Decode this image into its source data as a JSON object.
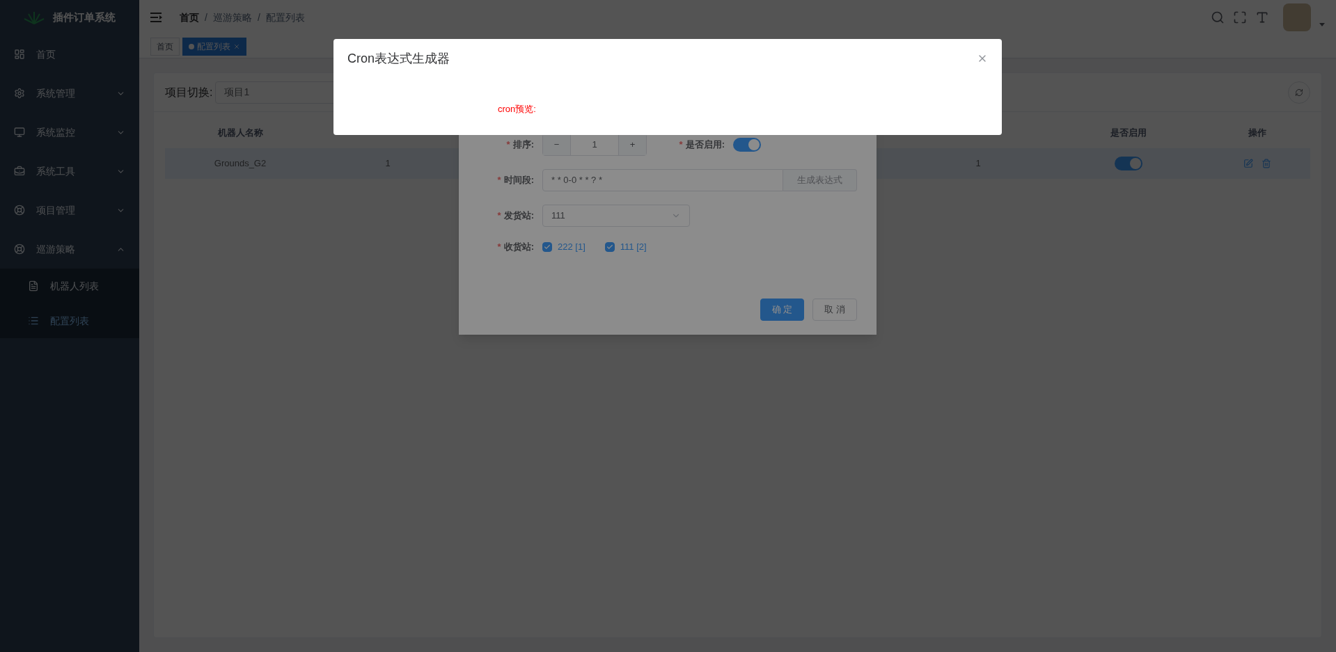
{
  "sidebar": {
    "logo_text": "插件订单系统",
    "menu": [
      {
        "label": "首页"
      },
      {
        "label": "系统管理",
        "expanded": false
      },
      {
        "label": "系统监控",
        "expanded": false
      },
      {
        "label": "系统工具",
        "expanded": false
      },
      {
        "label": "项目管理",
        "expanded": false
      },
      {
        "label": "巡游策略",
        "expanded": true,
        "children": [
          {
            "label": "机器人列表",
            "selected": false
          },
          {
            "label": "配置列表",
            "selected": true
          }
        ]
      }
    ]
  },
  "breadcrumb": {
    "separator": "/",
    "items": [
      "首页",
      "巡游策略",
      "配置列表"
    ]
  },
  "tags": [
    {
      "label": "首页",
      "selected": false
    },
    {
      "label": "配置列表",
      "selected": true
    }
  ],
  "filter": {
    "label": "项目切换:",
    "value": "项目1"
  },
  "table": {
    "columns": [
      {
        "header": "机器人名称"
      },
      {},
      {},
      {},
      {},
      {
        "header": "是否启用"
      },
      {
        "header": "操作"
      }
    ],
    "rows": [
      {
        "cells": [
          {
            "kind": "text",
            "text": "Grounds_G2"
          },
          {
            "kind": "text",
            "text": "1"
          },
          {
            "kind": "empty"
          },
          {
            "kind": "empty"
          },
          {
            "kind": "text",
            "text": "1"
          },
          {
            "kind": "switch",
            "on": true
          },
          {
            "kind": "actions"
          }
        ]
      }
    ]
  },
  "form": {
    "required_mark": "*",
    "rows": [
      [
        {
          "kind": "number",
          "label": "排序:",
          "required": true,
          "value": "1",
          "minus": "−",
          "plus": "+"
        },
        {
          "kind": "switch",
          "label": "是否启用:",
          "required": true,
          "on": true
        }
      ],
      [
        {
          "kind": "input_button",
          "label": "时间段:",
          "required": true,
          "value": "* * 0-0 * * ? *",
          "button": "生成表达式"
        }
      ],
      [
        {
          "kind": "select",
          "label": "发货站:",
          "required": true,
          "value": "111"
        }
      ],
      [
        {
          "kind": "checkboxes",
          "label": "收货站:",
          "required": true,
          "options": [
            {
              "label": "222 [1]",
              "checked": true
            },
            {
              "label": "111 [2]",
              "checked": true
            }
          ]
        }
      ]
    ],
    "buttons": [
      {
        "label": "确 定",
        "kind": "primary"
      },
      {
        "label": "取 消",
        "kind": "default"
      }
    ]
  },
  "cron_dialog": {
    "title": "Cron表达式生成器",
    "preview_label": "cron预览:"
  }
}
